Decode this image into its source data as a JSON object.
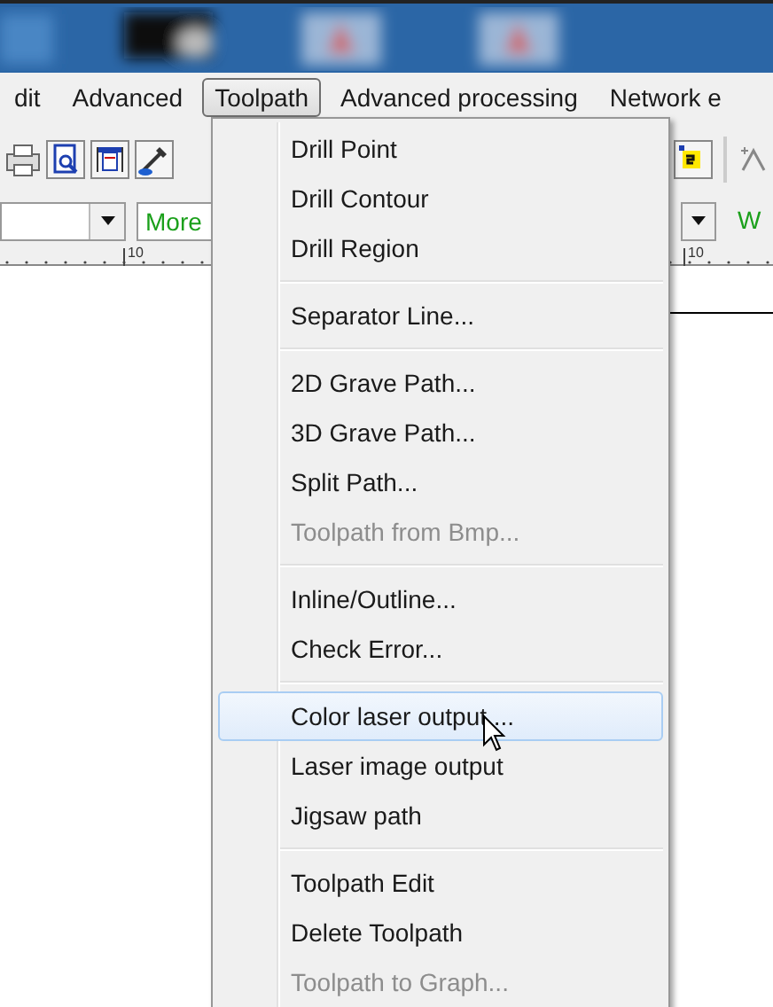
{
  "menu_bar": [
    {
      "label": "dit",
      "selected": false
    },
    {
      "label": "Advanced",
      "selected": false
    },
    {
      "label": "Toolpath",
      "selected": true
    },
    {
      "label": "Advanced processing",
      "selected": false
    },
    {
      "label": "Network e",
      "selected": false
    }
  ],
  "format_bar": {
    "field_1": "More",
    "field_2": "W"
  },
  "ruler": {
    "labels": [
      "10",
      "10"
    ]
  },
  "menu": {
    "items": [
      {
        "kind": "item",
        "label": "Drill Point",
        "disabled": false,
        "selected": false
      },
      {
        "kind": "item",
        "label": "Drill Contour",
        "disabled": false,
        "selected": false
      },
      {
        "kind": "item",
        "label": "Drill Region",
        "disabled": false,
        "selected": false
      },
      {
        "kind": "separator"
      },
      {
        "kind": "item",
        "label": "Separator Line...",
        "disabled": false,
        "selected": false
      },
      {
        "kind": "separator"
      },
      {
        "kind": "item",
        "label": "2D Grave Path...",
        "disabled": false,
        "selected": false
      },
      {
        "kind": "item",
        "label": "3D Grave Path...",
        "disabled": false,
        "selected": false
      },
      {
        "kind": "item",
        "label": "Split Path...",
        "disabled": false,
        "selected": false
      },
      {
        "kind": "item",
        "label": "Toolpath from Bmp...",
        "disabled": true,
        "selected": false
      },
      {
        "kind": "separator"
      },
      {
        "kind": "item",
        "label": "Inline/Outline...",
        "disabled": false,
        "selected": false
      },
      {
        "kind": "item",
        "label": "Check Error...",
        "disabled": false,
        "selected": false
      },
      {
        "kind": "separator"
      },
      {
        "kind": "item",
        "label": "Color laser output ...",
        "disabled": false,
        "selected": true
      },
      {
        "kind": "item",
        "label": "Laser image output",
        "disabled": false,
        "selected": false
      },
      {
        "kind": "item",
        "label": "Jigsaw path",
        "disabled": false,
        "selected": false
      },
      {
        "kind": "separator"
      },
      {
        "kind": "item",
        "label": "Toolpath Edit",
        "disabled": false,
        "selected": false
      },
      {
        "kind": "item",
        "label": "Delete Toolpath",
        "disabled": false,
        "selected": false
      },
      {
        "kind": "item",
        "label": "Toolpath to Graph...",
        "disabled": true,
        "selected": false
      }
    ]
  }
}
